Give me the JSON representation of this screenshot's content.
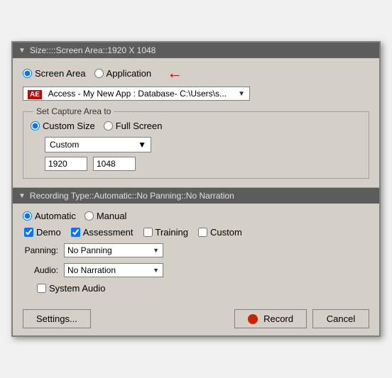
{
  "dialog": {
    "section1": {
      "header": "Size::::Screen Area::1920 X 1048",
      "screen_area_label": "Screen Area",
      "application_label": "Application",
      "app_dropdown": {
        "badge": "AE",
        "text": "Access - My New App : Database- C:\\Users\\s..."
      },
      "capture_group_label": "Set Capture Area to",
      "custom_size_label": "Custom Size",
      "full_screen_label": "Full Screen",
      "custom_dropdown_value": "Custom",
      "width_value": "1920",
      "height_value": "1048"
    },
    "section2": {
      "header": "Recording Type::Automatic::No Panning::No Narration",
      "automatic_label": "Automatic",
      "manual_label": "Manual",
      "demo_label": "Demo",
      "assessment_label": "Assessment",
      "training_label": "Training",
      "custom_label": "Custom",
      "panning_label": "Panning:",
      "panning_value": "No Panning",
      "audio_label": "Audio:",
      "audio_value": "No Narration",
      "system_audio_label": "System Audio"
    },
    "footer": {
      "settings_label": "Settings...",
      "record_label": "Record",
      "cancel_label": "Cancel"
    }
  }
}
